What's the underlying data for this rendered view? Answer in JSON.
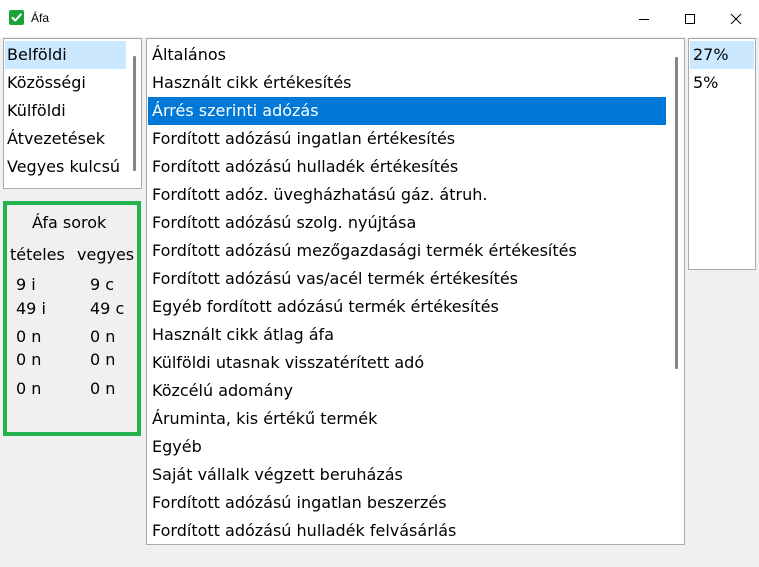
{
  "window": {
    "title": "Áfa"
  },
  "categories": {
    "items": [
      "Belföldi",
      "Közösségi",
      "Külföldi",
      "Átvezetések",
      "Vegyes kulcsú"
    ],
    "selected_index": 0
  },
  "afa_sorok": {
    "title": "Áfa sorok",
    "col_left_header": "tételes",
    "col_right_header": "vegyes",
    "rows": [
      {
        "left": "9 i",
        "right": "9 c"
      },
      {
        "left": "49 i",
        "right": "49 c"
      },
      {
        "left": "0 n",
        "right": "0 n"
      },
      {
        "left": "0 n",
        "right": "0 n"
      },
      {
        "left": "0 n",
        "right": "0 n"
      }
    ]
  },
  "types": {
    "items": [
      "Általános",
      "Használt cikk értékesítés",
      "Árrés szerinti adózás",
      "Fordított adózású ingatlan értékesítés",
      "Fordított adózású hulladék értékesítés",
      "Fordított adóz. üvegházhatású gáz. átruh.",
      "Fordított adózású szolg. nyújtása",
      "Fordított adózású mezőgazdasági termék értékesítés",
      "Fordított adózású vas/acél termék értékesítés",
      "Egyéb fordított adózású termék értékesítés",
      "Használt cikk átlag áfa",
      "Külföldi utasnak visszatérített adó",
      "Közcélú adomány",
      "Áruminta, kis értékű termék",
      "Egyéb",
      "Saját vállalk végzett beruházás",
      "Fordított adózású ingatlan beszerzés",
      "Fordított adózású hulladék felvásárlás"
    ],
    "selected_index": 2
  },
  "rates": {
    "items": [
      "27%",
      "5%"
    ],
    "selected_index": 0
  },
  "colors": {
    "selection": "#0078d7",
    "highlight": "#cce8ff",
    "afa_box_border": "#22b14c",
    "app_icon": "#1aa33a"
  }
}
